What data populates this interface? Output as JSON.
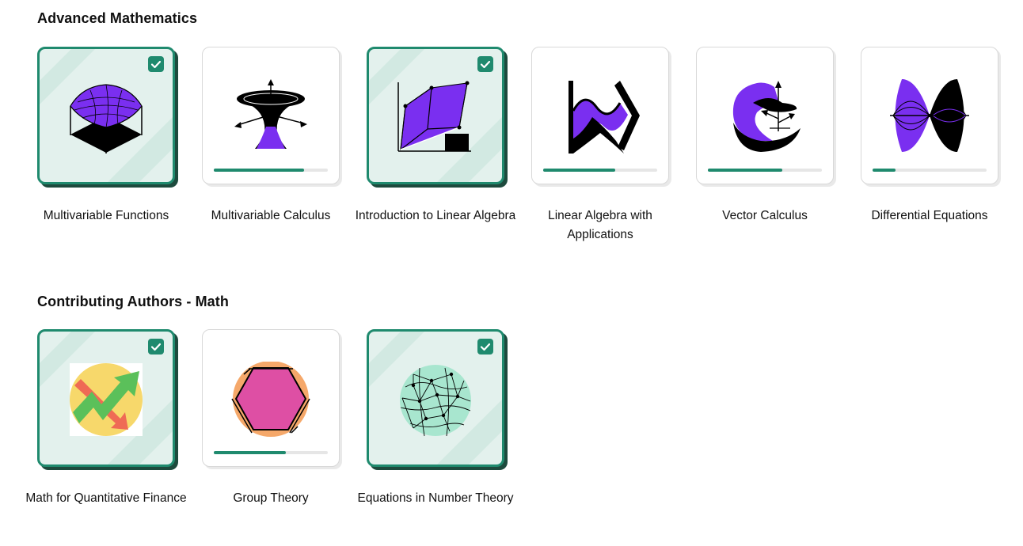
{
  "sections": [
    {
      "title": "Advanced Mathematics",
      "courses": [
        {
          "title": "Multivariable Functions",
          "completed": true,
          "icon": "surface-plot-icon"
        },
        {
          "title": "Multivariable Calculus",
          "completed": false,
          "progress": 0.79,
          "icon": "funnel-surface-icon"
        },
        {
          "title": "Introduction to Linear Algebra",
          "completed": true,
          "icon": "parallelepiped-icon"
        },
        {
          "title": "Linear Algebra with Applications",
          "completed": false,
          "progress": 0.63,
          "icon": "wave-transform-icon"
        },
        {
          "title": "Vector Calculus",
          "completed": false,
          "progress": 0.65,
          "icon": "vector-field-icon"
        },
        {
          "title": "Differential Equations",
          "completed": false,
          "progress": 0.2,
          "icon": "standing-wave-icon"
        }
      ]
    },
    {
      "title": "Contributing Authors - Math",
      "courses": [
        {
          "title": "Math for Quantitative Finance",
          "completed": true,
          "icon": "finance-arrows-icon"
        },
        {
          "title": "Group Theory",
          "completed": false,
          "progress": 0.63,
          "icon": "hexagon-icon"
        },
        {
          "title": "Equations in Number Theory",
          "completed": true,
          "icon": "network-sphere-icon"
        }
      ]
    }
  ],
  "colors": {
    "accent": "#1f8a6e",
    "completed_bg": "#e3f1ed",
    "completed_shadow": "#1d4a3d",
    "purple": "#7a2ff0"
  }
}
